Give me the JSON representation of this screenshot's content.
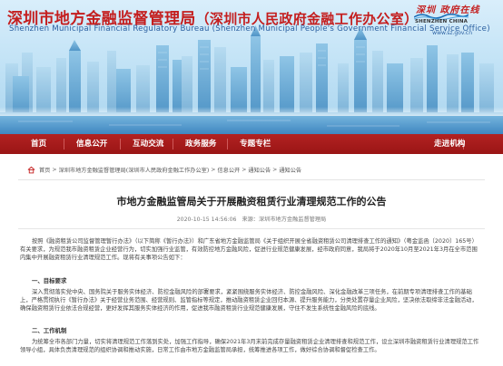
{
  "header": {
    "title_main": "深圳市地方金融监督管理局",
    "title_sub": "（深圳市人民政府金融工作办公室）",
    "title_en": "Shenzhen Municipal Financial Regulatory Bureau (Shenzhen Municipal People's Government Financial Service Office)",
    "logo_cn": "深圳 政府在线",
    "logo_en": "SHENZHEN CHINA",
    "url": "www.sz.gov.cn"
  },
  "nav": {
    "items": [
      {
        "label": "首页"
      },
      {
        "label": "信息公开"
      },
      {
        "label": "互动交流"
      },
      {
        "label": "政务服务"
      },
      {
        "label": "专题专栏"
      },
      {
        "label": "走进机构"
      }
    ]
  },
  "breadcrumb": {
    "items": [
      "首页",
      "深圳市地方金融监督管理局(深圳市人民政府金融工作办公室)",
      "信息公开",
      "通知公告",
      "通知公告"
    ],
    "separator": ">"
  },
  "article": {
    "title": "市地方金融监管局关于开展融资租赁行业清理规范工作的公告",
    "date": "2020-10-15 14:56:06",
    "source_label": "来源：深圳市地方金融监督管理局",
    "paragraphs": [
      "按照《融资租赁公司监督管理暂行办法》（以下简称《暂行办法》）和广东省地方金融监管局《关于组织开展全省融资租赁公司清理排查工作的通知》（粤金监函〔2020〕165号）有关要求，为规范我市融资租赁企业经营行为，切实加强行业监管，有效防控地方金融风险，促进行业规范健康发展，经市政府同意，我局将于2020年10月至2021年3月在全市范围内集中开展融资租赁行业清理规范工作。现将有关事项公告如下：",
      "深入贯彻落实党中央、国务院关于服务实体经济、防控金融风险的部署要求，紧紧围绕服务实体经济、防控金融风险、深化金融改革三项任务，在前期专项清理排查工作的基础上，严格贯彻执行《暂行办法》关于经营业务范围、经营规则、监管指标等规定，推动融资租赁企业回归本源、提升服务能力，分类处置存量企业风险，坚决依法取缔非法金融活动，确保融资租赁行业依法合规经营，更好发挥其服务实体经济的作用，促进我市融资租赁行业规范健康发展，守住不发生系统性金融风险的底线。",
      "为统筹全市各部门力量，切实将清理规范工作落到实处，加强工作指导，确保2021年3月末前完成存量融资租赁企业清理排查和规范工作，设立深圳市融资租赁行业清理规范工作领导小组，具体负责清理规范的组织协调和推动实施，日常工作由市地方金融监管局承担，统筹推进各项工作，做好综合协调和督促检查工作。"
    ],
    "headings": [
      "一、目标要求",
      "二、工作机制"
    ]
  }
}
